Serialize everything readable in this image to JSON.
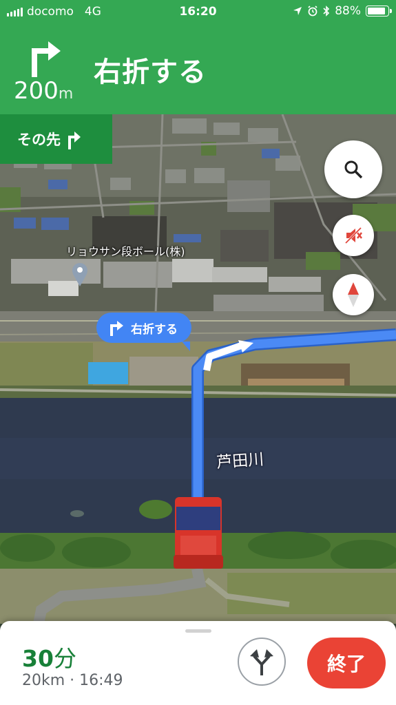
{
  "status_bar": {
    "carrier": "docomo",
    "network": "4G",
    "time": "16:20",
    "battery_percent": "88%",
    "battery_level": 0.88,
    "icons": [
      "location-arrow-icon",
      "alarm-icon",
      "bluetooth-icon"
    ]
  },
  "navigation": {
    "maneuver_icon": "turn-right-icon",
    "distance_value": "200",
    "distance_unit": "m",
    "instruction": "右折する",
    "next_label": "その先",
    "next_icon": "turn-right-icon"
  },
  "map": {
    "poi_name": "リョウサン段ボール(株)",
    "river_name": "芦田川",
    "callout_text": "右折する",
    "buttons": [
      "search-icon",
      "mute-icon",
      "compass-icon"
    ]
  },
  "trip": {
    "duration_value": "30",
    "duration_unit": "分",
    "detail": "20km · 16:49",
    "end_label": "終了"
  },
  "colors": {
    "nav_green": "#34a853",
    "dark_green": "#1e8e3e",
    "route_blue": "#4285f4",
    "end_red": "#ea4335",
    "eta_green": "#188038"
  }
}
